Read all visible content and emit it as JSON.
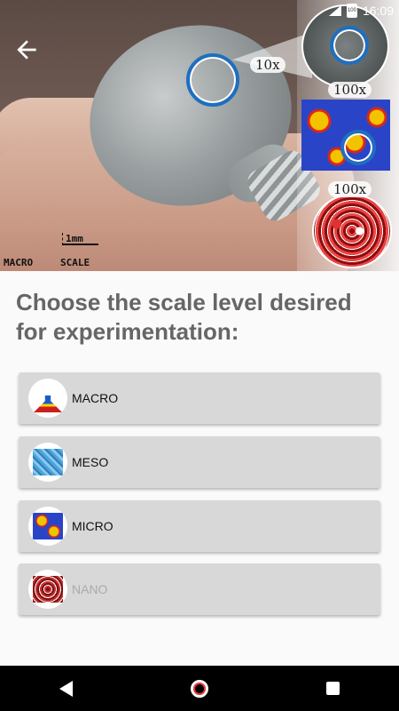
{
  "status_bar": {
    "time": "16:09",
    "battery": "100"
  },
  "hero": {
    "zoom_labels": [
      "10x",
      "100x",
      "100x"
    ],
    "scale_length": "1mm",
    "scale_caption_left": "MACRO",
    "scale_caption_right": "SCALE"
  },
  "prompt": "Choose the scale level desired for experimentation:",
  "options": [
    {
      "label": "MACRO",
      "enabled": true
    },
    {
      "label": "MESO",
      "enabled": true
    },
    {
      "label": "MICRO",
      "enabled": true
    },
    {
      "label": "NANO",
      "enabled": false
    }
  ],
  "icons": {
    "back": "arrow-left-icon",
    "nav_back": "triangle-back-icon",
    "nav_home": "circle-home-icon",
    "nav_recent": "square-recent-icon"
  }
}
